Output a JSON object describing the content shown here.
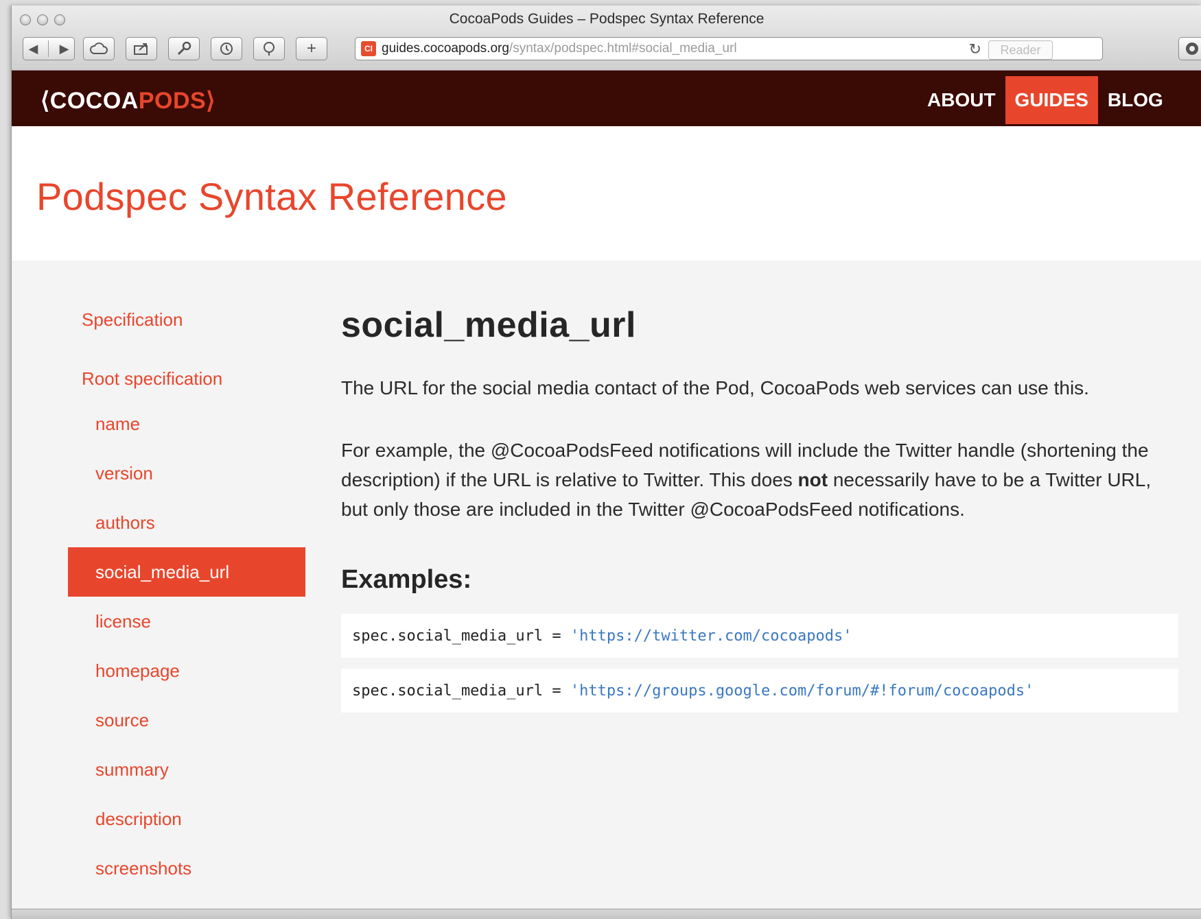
{
  "window": {
    "title": "CocoaPods Guides – Podspec Syntax Reference"
  },
  "toolbar": {
    "url_host": "guides.cocoapods.org",
    "url_path": "/syntax/podspec.html#social_media_url",
    "reader_label": "Reader",
    "favicon_text": "CI"
  },
  "header": {
    "logo_left": "⟨COCOA",
    "logo_right": "PODS⟩",
    "nav": [
      "ABOUT",
      "GUIDES",
      "BLOG"
    ],
    "active_nav": "GUIDES"
  },
  "page": {
    "title": "Podspec Syntax Reference"
  },
  "sidebar": {
    "top_items": [
      "Specification",
      "Root specification"
    ],
    "sub_items": [
      "name",
      "version",
      "authors",
      "social_media_url",
      "license",
      "homepage",
      "source",
      "summary",
      "description",
      "screenshots"
    ],
    "active_item": "social_media_url"
  },
  "content": {
    "heading": "social_media_url",
    "para1": "The URL for the social media contact of the Pod, CocoaPods web services can use this.",
    "para2_before": "For example, the @CocoaPodsFeed notifications will include the Twitter handle (shortening the description) if the URL is relative to Twitter. This does ",
    "para2_bold": "not",
    "para2_after": " necessarily have to be a Twitter URL, but only those are included in the Twitter @CocoaPodsFeed notifications.",
    "examples_heading": "Examples:",
    "examples": [
      {
        "code": "spec.social_media_url = ",
        "string": "'https://twitter.com/cocoapods'"
      },
      {
        "code": "spec.social_media_url = ",
        "string": "'https://groups.google.com/forum/#!forum/cocoapods'"
      }
    ]
  },
  "colors": {
    "brand": "#e8462c",
    "header_bg": "#3a0a05"
  }
}
